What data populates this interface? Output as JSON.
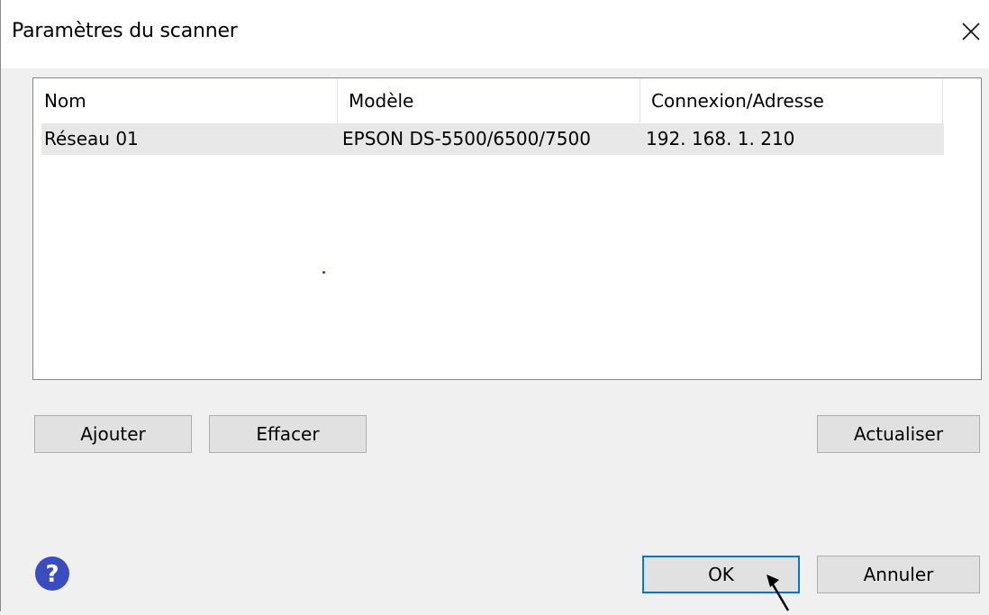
{
  "dialog": {
    "title": "Paramètres du scanner",
    "close_icon": "close-icon"
  },
  "scanner_list": {
    "columns": [
      "Nom",
      "Modèle",
      "Connexion/Adresse"
    ],
    "rows": [
      {
        "name": "Réseau 01",
        "model": "EPSON DS-5500/6500/7500",
        "address": "192. 168. 1. 210"
      }
    ]
  },
  "actions": {
    "add_label": "Ajouter",
    "delete_label": "Effacer",
    "refresh_label": "Actualiser",
    "ok_label": "OK",
    "cancel_label": "Annuler"
  },
  "help": {
    "icon": "help-icon",
    "color": "#3b4cc0"
  },
  "colors": {
    "focus_border": "#0078d7",
    "selected_row": "#e8e8e8"
  }
}
